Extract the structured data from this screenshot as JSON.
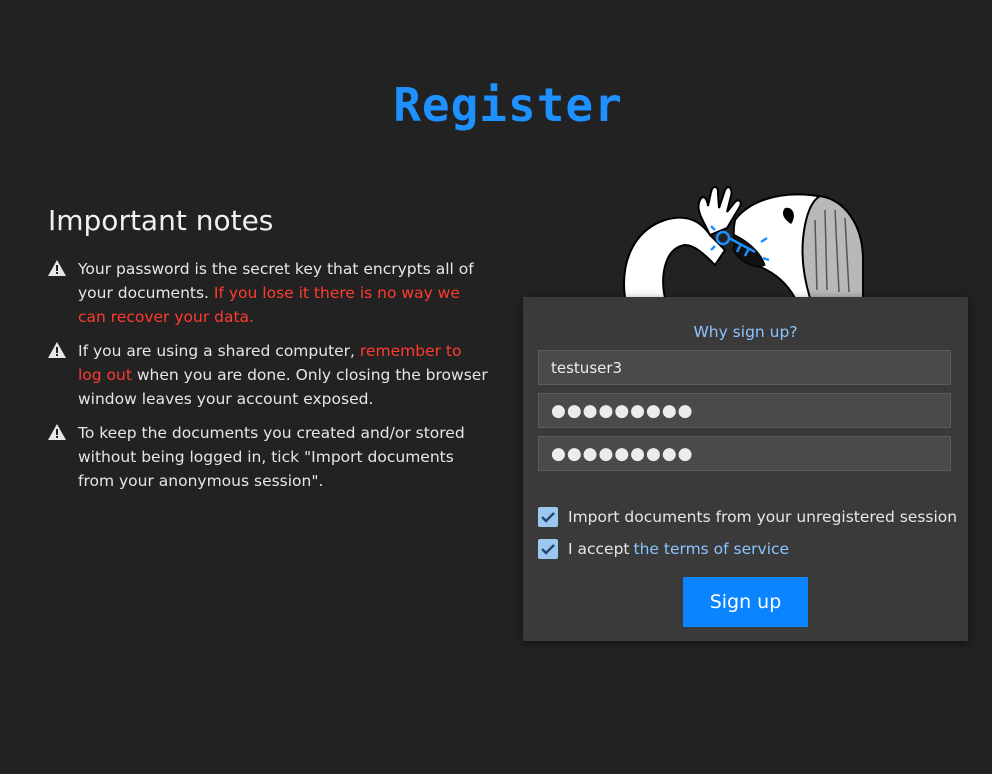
{
  "page": {
    "title": "Register"
  },
  "notes": {
    "heading": "Important notes",
    "items": [
      {
        "text": "Your password is the secret key that encrypts all of your documents. ",
        "highlight": "If you lose it there is no way we can recover your data.",
        "after": ""
      },
      {
        "text": "If you are using a shared computer, ",
        "highlight": "remember to log out",
        "after": " when you are done. Only closing the browser window leaves your account exposed."
      },
      {
        "text": "To keep the documents you created and/or stored without being logged in, tick \"Import documents from your anonymous session\".",
        "highlight": "",
        "after": ""
      }
    ]
  },
  "form": {
    "why_link": "Why sign up?",
    "username_value": "testuser3",
    "password_value": "●●●●●●●●●",
    "confirm_value": "●●●●●●●●●",
    "import_label": "Import documents from your unregistered session",
    "import_checked": true,
    "accept_prefix": "I accept",
    "accept_link": "the terms of service",
    "accept_checked": true,
    "submit_label": "Sign up"
  },
  "colors": {
    "background": "#222222",
    "title": "#1e90ff",
    "warning_text": "#ff3b30",
    "link": "#8cc4ff",
    "button": "#0a84ff",
    "panel": "#3a3a3a"
  }
}
